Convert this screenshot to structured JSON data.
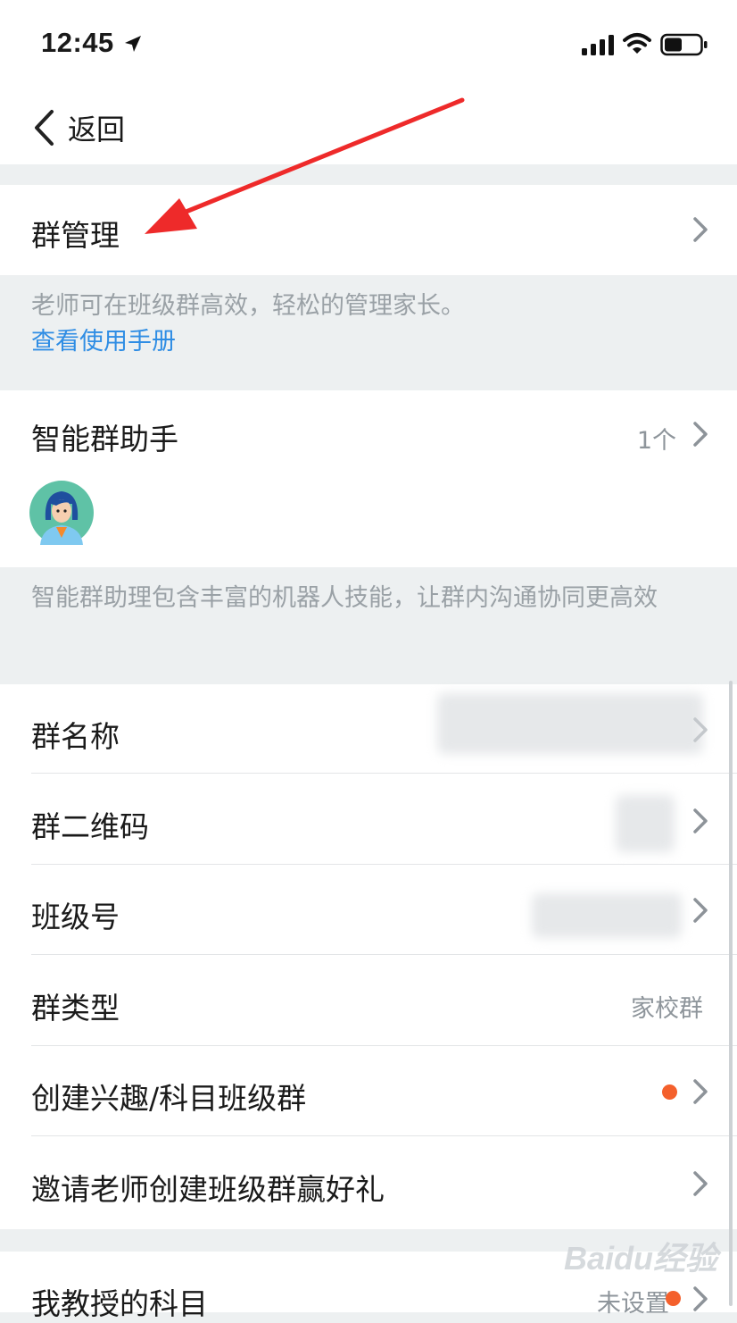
{
  "status": {
    "time": "12:45"
  },
  "nav": {
    "back_label": "返回"
  },
  "group_manage": {
    "title": "群管理",
    "note": "老师可在班级群高效，轻松的管理家长。",
    "link": "查看使用手册"
  },
  "assistant": {
    "title": "智能群助手",
    "count": "1个",
    "note": "智能群助理包含丰富的机器人技能，让群内沟通协同更高效"
  },
  "rows": {
    "name": "群名称",
    "qrcode": "群二维码",
    "class_no": "班级号",
    "type_label": "群类型",
    "type_value": "家校群",
    "create": "创建兴趣/科目班级群",
    "invite": "邀请老师创建班级群赢好礼"
  },
  "subject": {
    "title": "我教授的科目",
    "value": "未设置"
  },
  "watermark": "Baidu经验",
  "colors": {
    "accent_link": "#2f8de4",
    "badge_dot": "#f4602c",
    "arrow": "#ee2a2a"
  }
}
